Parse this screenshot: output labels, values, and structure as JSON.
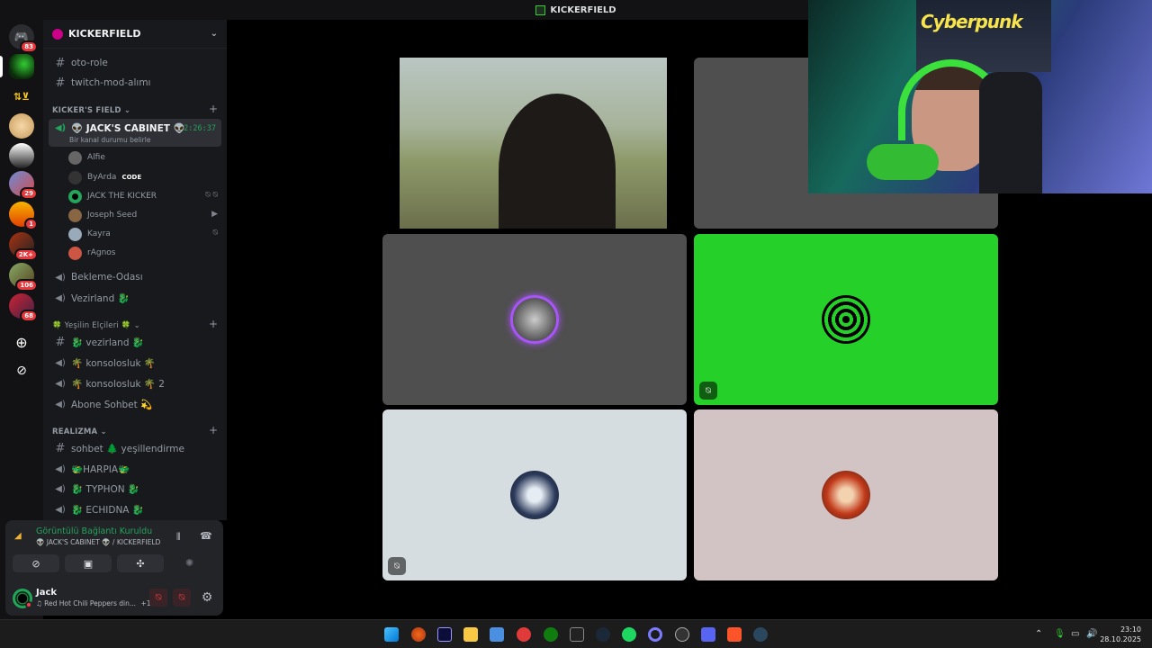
{
  "window": {
    "title": "KICKERFIELD"
  },
  "server": {
    "name": "KICKERFIELD"
  },
  "rail": {
    "badges": [
      "83",
      "29",
      "1",
      "2K+",
      "106",
      "68"
    ]
  },
  "channels": {
    "top": [
      "oto-role",
      "twitch-mod-alımı"
    ],
    "categories": {
      "kickers_field": "KICKER'S FIELD",
      "yesilin": "🍀 Yeşilin Elçileri 🍀",
      "realizma": "REALIZMA"
    },
    "active_voice": {
      "name": "👽 JACK'S CABINET 👽",
      "status": "Bir kanal durumu belirle",
      "timer": "2:26:37"
    },
    "voice_users": [
      {
        "name": "Alfie"
      },
      {
        "name": "ByArda",
        "tag": "CODE"
      },
      {
        "name": "JACK THE KICKER"
      },
      {
        "name": "Joseph Seed"
      },
      {
        "name": "Kayra"
      },
      {
        "name": "rAgnos"
      }
    ],
    "after_users": [
      "Bekleme-Odası",
      "Vezirland 🐉"
    ],
    "yesilin_items": [
      "🐉 vezirland 🐉",
      "🌴 konsolosluk 🌴",
      "🌴 konsolosluk 🌴 2",
      "Abone Sohbet 💫"
    ],
    "realizma_items": [
      "sohbet 🌲 yeşillendirme",
      "🐲HARPIA🐲",
      "🐉 TYPHON 🐉",
      "🐉 ECHIDNA 🐉"
    ]
  },
  "voice_panel": {
    "status": "Görüntülü Bağlantı Kuruldu",
    "location": "👽 JACK'S CABINET 👽 / KICKERFIELD"
  },
  "user_panel": {
    "name": "Jack",
    "activity": "♫ Red Hot Chili Peppers din...",
    "extra": "+1"
  },
  "taskbar": {
    "time": "23:10",
    "date": "28.10.2025"
  },
  "colors": {
    "green_tile": "#25d128",
    "grey_tile": "#4f4f4f",
    "light_tile": "#d6dde0",
    "pink_tile": "#d2c4c4",
    "accent": "#23a55a"
  }
}
